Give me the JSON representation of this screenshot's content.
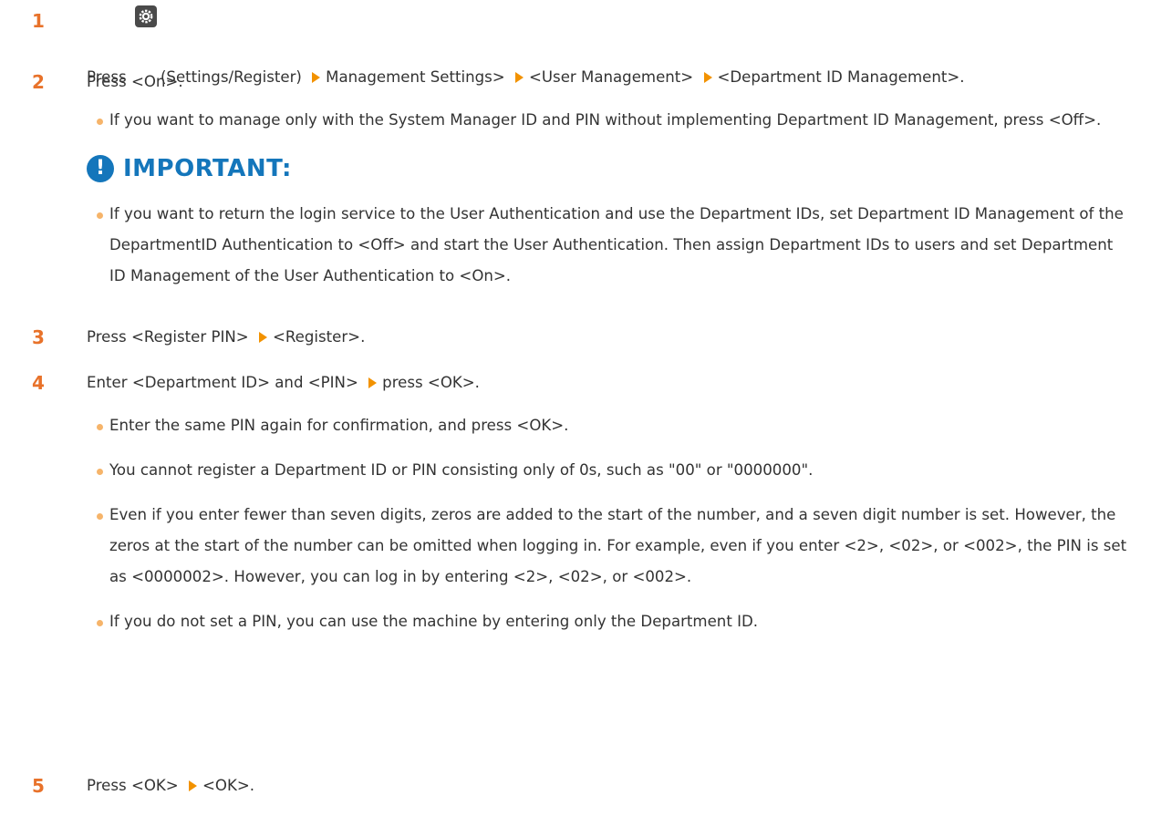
{
  "colors": {
    "step_number": "#e8722a",
    "arrow": "#f29200",
    "bullet": "#f6b46a",
    "important": "#1476bb",
    "text": "#333333"
  },
  "steps": [
    {
      "number": "1",
      "parts": [
        "Press",
        "(Settings/Register)",
        "Management Settings>",
        "<User Management>",
        "<Department ID Management>."
      ]
    },
    {
      "number": "2",
      "text": "Press <On>.",
      "bullets": [
        "If you want to manage only with the System Manager ID and PIN without implementing Department ID Management, press <Off>."
      ]
    },
    {
      "number": "3",
      "parts": [
        "Press <Register PIN>",
        "<Register>."
      ]
    },
    {
      "number": "4",
      "parts": [
        "Enter <Department ID> and <PIN>",
        "press <OK>."
      ],
      "bullets": [
        "Enter the same PIN again for confirmation, and press <OK>.",
        "You cannot register a Department ID or PIN consisting only of 0s, such as \"00\" or \"0000000\".",
        "Even if you enter fewer than seven digits, zeros are added to the start of the number, and a seven digit number is set. However, the zeros at the start of the number can be omitted when logging in. For example, even if you enter <2>, <02>, or <002>, the PIN is set as <0000002>. However, you can log in by entering <2>, <02>, or <002>.",
        "If you do not set a PIN, you can use the machine by entering only the Department ID."
      ]
    },
    {
      "number": "5",
      "parts": [
        "Press <OK>",
        "<OK>."
      ]
    }
  ],
  "important": {
    "icon": "exclamation-icon",
    "title": "IMPORTANT:",
    "bullets": [
      "If you want to return the login service to the User Authentication and use the Department IDs, set Department ID Management of the DepartmentID Authentication to <Off> and start the User Authentication. Then assign Department IDs to users and set Department ID Management of the User Authentication to <On>."
    ]
  }
}
